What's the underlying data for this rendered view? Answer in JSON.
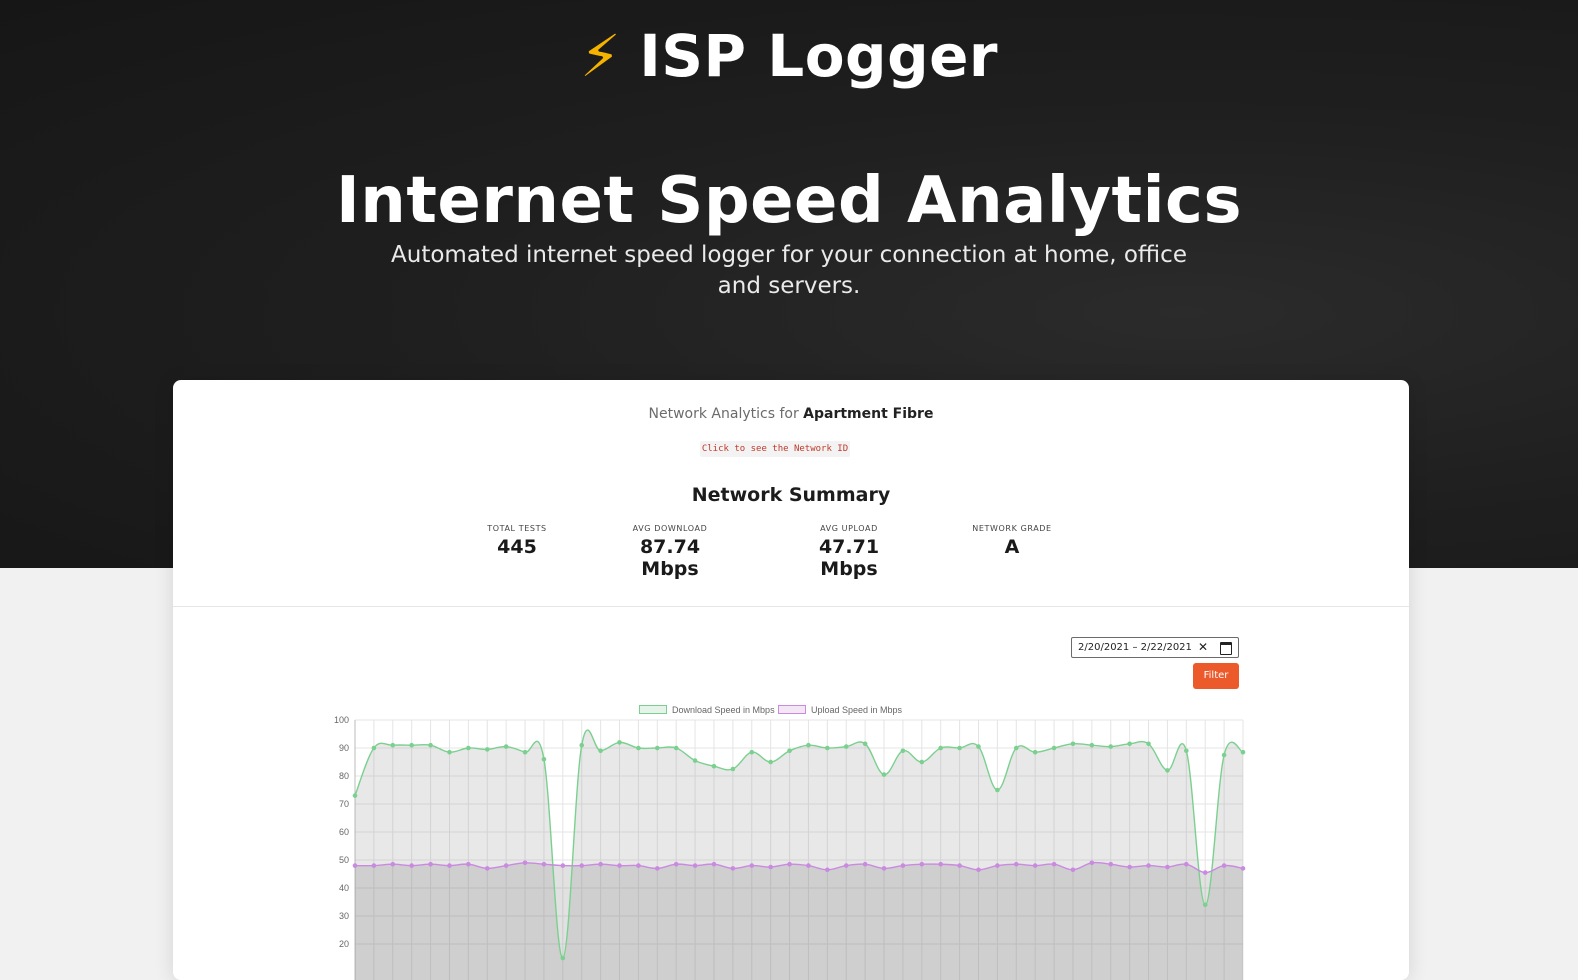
{
  "brand": {
    "icon": "lightning-bolt-icon",
    "icon_glyph": "⚡",
    "name": "ISP Logger"
  },
  "hero": {
    "title": "Internet Speed Analytics",
    "subtitle": "Automated internet speed logger for your connection at home, office and servers."
  },
  "network": {
    "prefix": "Network Analytics for",
    "name": "Apartment Fibre",
    "id_button": "Click to see the Network ID"
  },
  "summary": {
    "title": "Network Summary",
    "stats": [
      {
        "label": "TOTAL TESTS",
        "value": "445"
      },
      {
        "label": "AVG DOWNLOAD",
        "value": "87.74 Mbps"
      },
      {
        "label": "AVG UPLOAD",
        "value": "47.71 Mbps"
      },
      {
        "label": "NETWORK GRADE",
        "value": "A"
      }
    ]
  },
  "filter": {
    "date_range": "2/20/2021 –  2/22/2021",
    "clear_glyph": "✕",
    "button": "Filter"
  },
  "colors": {
    "accent": "#ec5a2c",
    "download": "#7bd08f",
    "upload": "#c98ae0"
  },
  "chart_data": {
    "type": "line",
    "ylim": [
      10,
      100
    ],
    "yticks": [
      100,
      90,
      80,
      70,
      60,
      50,
      40,
      30,
      20
    ],
    "x_count": 48,
    "series": [
      {
        "name": "Download Speed in Mbps",
        "color": "#7bd08f",
        "values": [
          73,
          90,
          91,
          91,
          91,
          88.5,
          90,
          89.5,
          90.5,
          88.5,
          86,
          15,
          91,
          89,
          92,
          90,
          90,
          90,
          85.5,
          83.5,
          82.5,
          88.5,
          85,
          89,
          91,
          90,
          90.5,
          91.5,
          80.5,
          89,
          85,
          90,
          90,
          90.5,
          75,
          90,
          88.5,
          90,
          91.5,
          91,
          90.5,
          91.5,
          91.5,
          82,
          89,
          34,
          87.5,
          88.5
        ]
      },
      {
        "name": "Upload Speed in Mbps",
        "color": "#c98ae0",
        "values": [
          48,
          48,
          48.5,
          48,
          48.5,
          48,
          48.5,
          47,
          48,
          49,
          48.5,
          48,
          48,
          48.5,
          48,
          48,
          47,
          48.5,
          48,
          48.5,
          47,
          48,
          47.5,
          48.5,
          48,
          46.5,
          48,
          48.5,
          47,
          48,
          48.5,
          48.5,
          48,
          46.5,
          48,
          48.5,
          48,
          48.5,
          46.5,
          49,
          48.5,
          47.5,
          48,
          47.5,
          48.5,
          45.5,
          48,
          47
        ]
      }
    ]
  }
}
